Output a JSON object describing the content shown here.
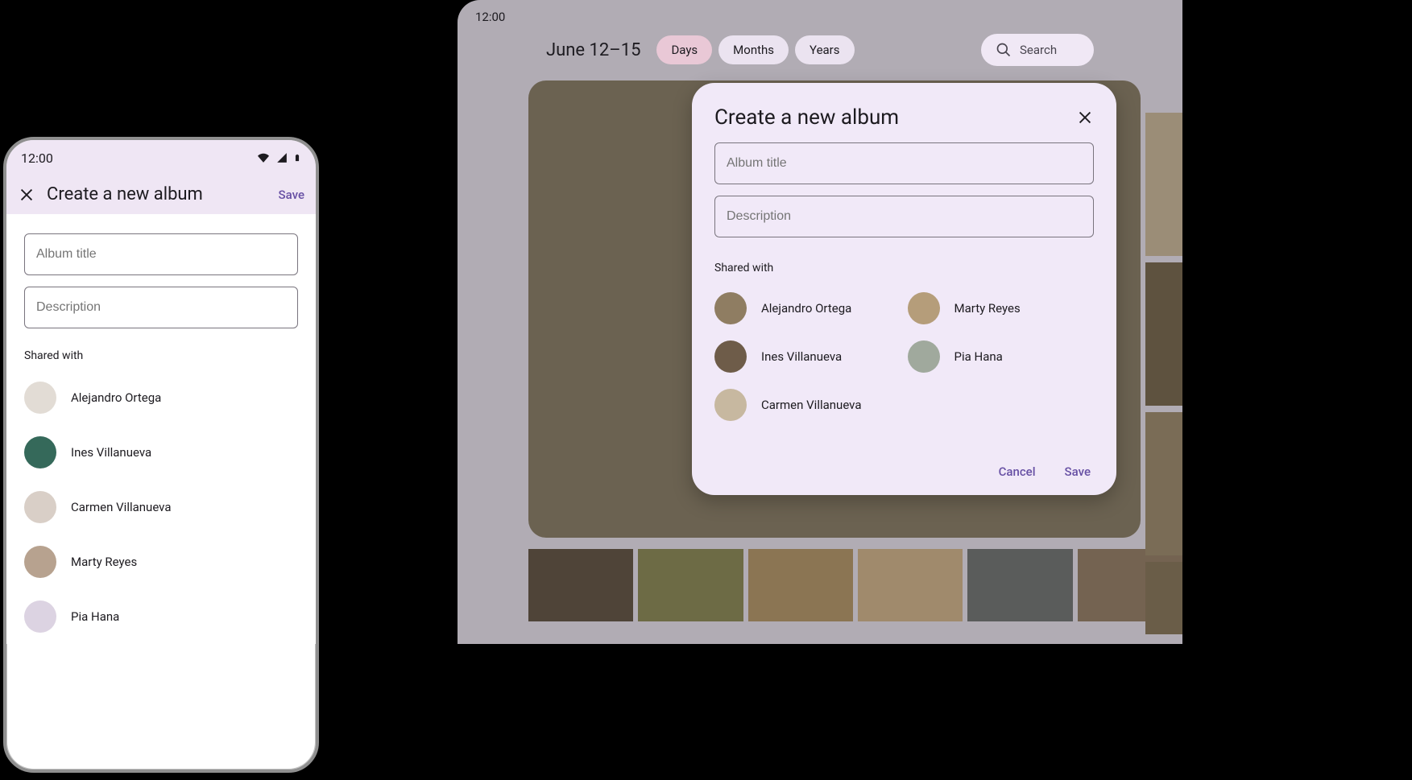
{
  "phone": {
    "status_time": "12:00",
    "topbar": {
      "title": "Create a new album",
      "save_label": "Save"
    },
    "fields": {
      "album_title_placeholder": "Album title",
      "description_placeholder": "Description"
    },
    "shared_label": "Shared with",
    "people": [
      {
        "name": "Alejandro Ortega",
        "avatar_color": "c0"
      },
      {
        "name": "Ines Villanueva",
        "avatar_color": "c1"
      },
      {
        "name": "Carmen Villanueva",
        "avatar_color": "c2"
      },
      {
        "name": "Marty Reyes",
        "avatar_color": "c3"
      },
      {
        "name": "Pia Hana",
        "avatar_color": "c4"
      }
    ]
  },
  "tablet": {
    "status_time": "12:00",
    "date_range": "June 12–15",
    "tabs": [
      {
        "label": "Days",
        "active": true
      },
      {
        "label": "Months",
        "active": false
      },
      {
        "label": "Years",
        "active": false
      }
    ],
    "search_placeholder": "Search",
    "dialog": {
      "title": "Create a new album",
      "fields": {
        "album_title_placeholder": "Album title",
        "description_placeholder": "Description"
      },
      "shared_label": "Shared with",
      "people": [
        {
          "name": "Alejandro Ortega",
          "avatar_color": "c5"
        },
        {
          "name": "Marty Reyes",
          "avatar_color": "c6"
        },
        {
          "name": "Ines Villanueva",
          "avatar_color": "c7"
        },
        {
          "name": "Pia Hana",
          "avatar_color": "c8"
        },
        {
          "name": "Carmen Villanueva",
          "avatar_color": "c9"
        }
      ],
      "actions": {
        "cancel_label": "Cancel",
        "save_label": "Save"
      }
    }
  }
}
